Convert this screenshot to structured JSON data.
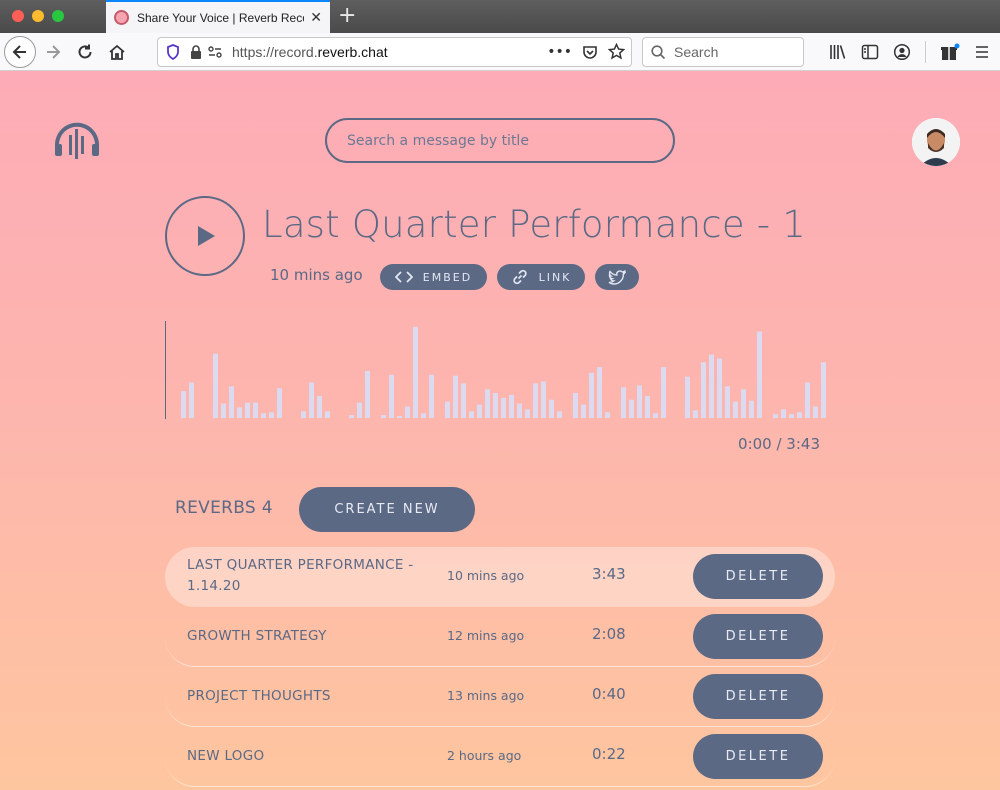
{
  "browser": {
    "tab_title": "Share Your Voice | Reverb Record",
    "url_prefix": "https://record.",
    "url_domain": "reverb.chat",
    "search_placeholder": "Search",
    "new_tab_label": "+",
    "tab_close_label": "✕"
  },
  "page": {
    "search_placeholder": "Search a message by title",
    "track": {
      "title": "Last Quarter Performance - 1",
      "time_ago": "10 mins ago",
      "embed_label": "EMBED",
      "link_label": "LINK",
      "playback_time": "0:00 / 3:43",
      "waveform": [
        0.28,
        0.37,
        0,
        0,
        0.67,
        0.15,
        0.33,
        0.11,
        0.16,
        0.16,
        0.05,
        0.06,
        0.31,
        0,
        0,
        0.07,
        0.37,
        0.23,
        0.07,
        0,
        0,
        0.03,
        0.16,
        0.49,
        0,
        0.03,
        0.45,
        0.02,
        0.12,
        0.95,
        0.05,
        0.45,
        0,
        0.17,
        0.44,
        0.36,
        0.07,
        0.14,
        0.3,
        0.26,
        0.21,
        0.24,
        0.15,
        0.09,
        0.36,
        0.38,
        0.19,
        0.07,
        0,
        0.26,
        0.14,
        0.47,
        0.53,
        0.06,
        0,
        0.32,
        0.19,
        0.34,
        0.23,
        0.05,
        0.53,
        0,
        0,
        0.43,
        0.08,
        0.58,
        0.66,
        0.62,
        0.33,
        0.17,
        0.3,
        0.18,
        0.9,
        0,
        0.04,
        0.09,
        0.04,
        0.06,
        0.37,
        0.12,
        0.58
      ]
    },
    "reverbs": {
      "label": "REVERBS 4",
      "create_label": "CREATE NEW",
      "delete_label": "DELETE",
      "items": [
        {
          "title": "LAST QUARTER PERFORMANCE - 1.14.20",
          "time_ago": "10 mins ago",
          "duration": "3:43",
          "active": true
        },
        {
          "title": "GROWTH STRATEGY",
          "time_ago": "12 mins ago",
          "duration": "2:08",
          "active": false
        },
        {
          "title": "PROJECT THOUGHTS",
          "time_ago": "13 mins ago",
          "duration": "0:40",
          "active": false
        },
        {
          "title": "NEW LOGO",
          "time_ago": "2 hours ago",
          "duration": "0:22",
          "active": false
        }
      ]
    }
  },
  "colors": {
    "accent": "#5b6985",
    "wave_bar": "#dbdaf0"
  }
}
